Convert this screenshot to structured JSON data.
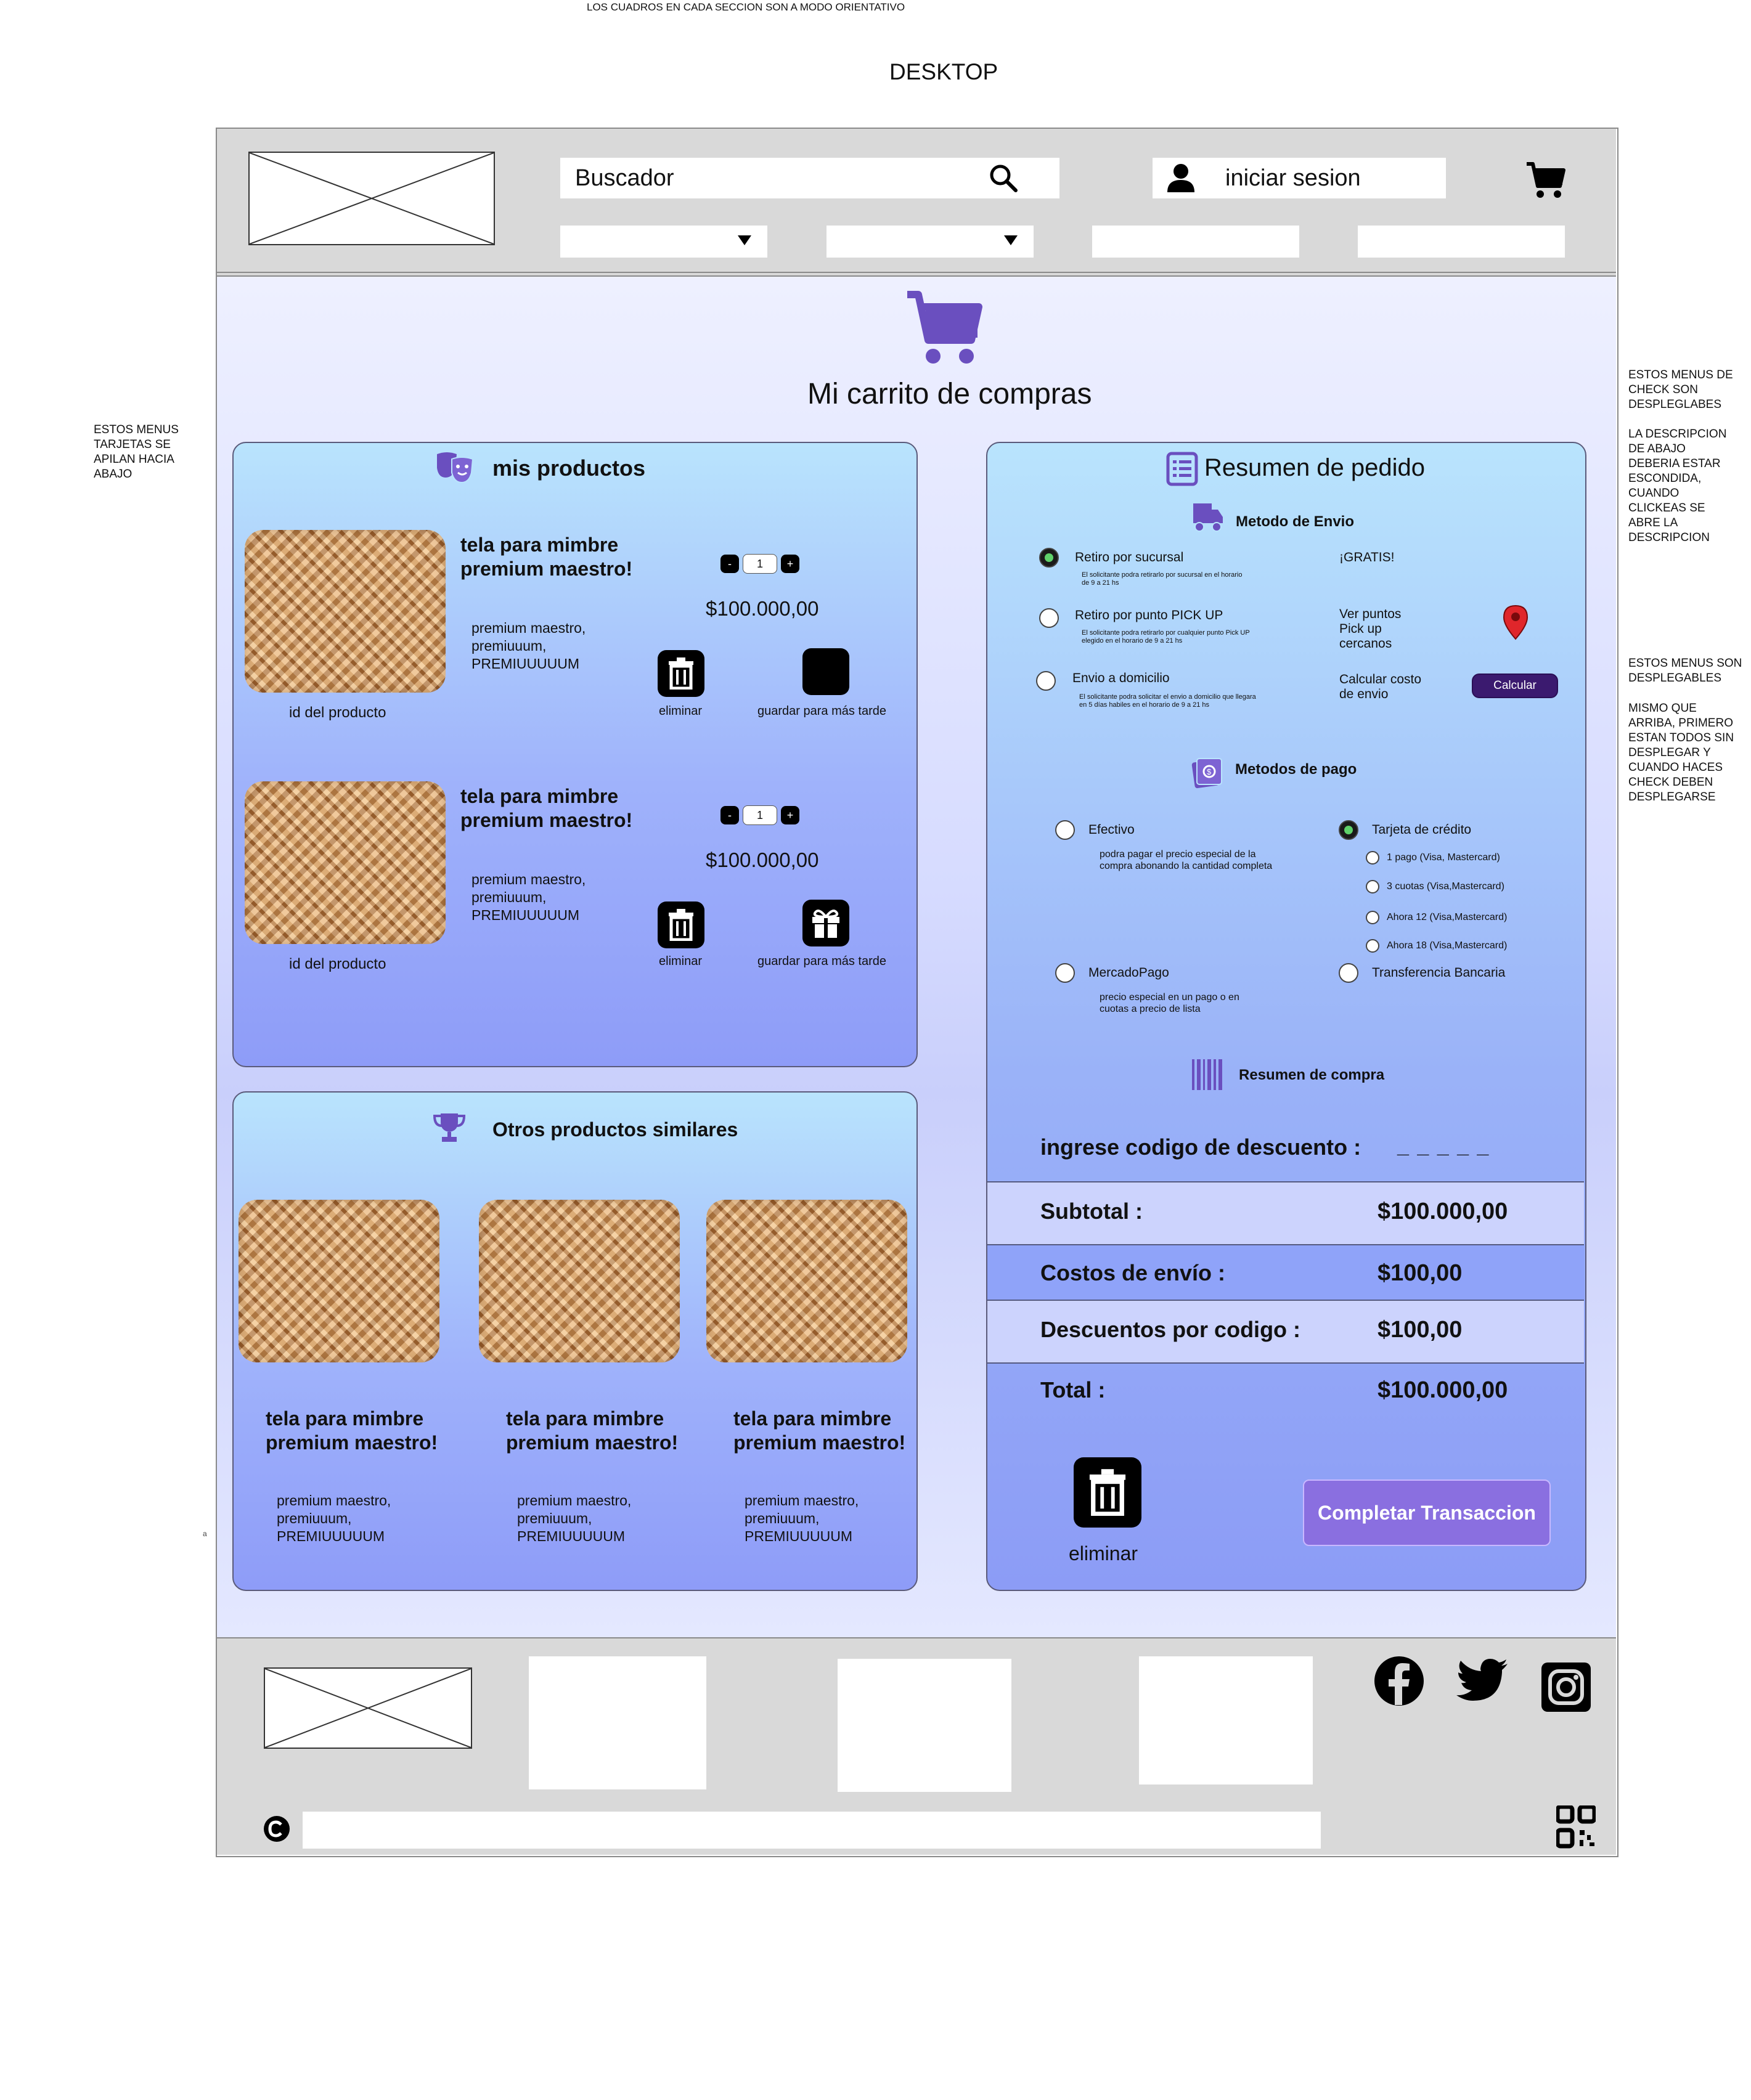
{
  "notes": {
    "top": "LOS CUADROS EN CADA SECCION SON A MODO ORIENTATIVO",
    "heading": "DESKTOP",
    "left": "ESTOS MENUS TARJETAS SE APILAN HACIA ABAJO",
    "right_1a": "ESTOS MENUS DE CHECK SON DESPLEGLABES",
    "right_1b": "LA DESCRIPCION DE ABAJO DEBERIA ESTAR ESCONDIDA, CUANDO CLICKEAS SE ABRE LA DESCRIPCION",
    "right_2a": "ESTOS MENUS SON DESPLEGABLES",
    "right_2b": "MISMO QUE ARRIBA, PRIMERO ESTAN TODOS SIN DESPLEGAR Y CUANDO HACES CHECK DEBEN DESPLEGARSE",
    "stray": "a"
  },
  "header": {
    "search_placeholder": "Buscador",
    "login_label": "iniciar sesion"
  },
  "page": {
    "title": "Mi carrito de compras"
  },
  "products_panel": {
    "title": "mis productos",
    "items": [
      {
        "name": "tela para mimbre premium maestro!",
        "description": "premium maestro, premiuuum, PREMIUUUUUM",
        "id_label": "id del producto",
        "qty_minus": "-",
        "qty": "1",
        "qty_plus": "+",
        "price": "$100.000,00",
        "delete_label": "eliminar",
        "save_label": "guardar para más tarde"
      },
      {
        "name": "tela para mimbre premium maestro!",
        "description": "premium maestro, premiuuum, PREMIUUUUUM",
        "id_label": "id del producto",
        "qty_minus": "-",
        "qty": "1",
        "qty_plus": "+",
        "price": "$100.000,00",
        "delete_label": "eliminar",
        "save_label": "guardar para más tarde"
      }
    ]
  },
  "similar_panel": {
    "title": "Otros productos similares",
    "items": [
      {
        "name": "tela para mimbre premium maestro!",
        "description": "premium maestro, premiuuum, PREMIUUUUUM"
      },
      {
        "name": "tela para mimbre premium maestro!",
        "description": "premium maestro, premiuuum, PREMIUUUUUM"
      },
      {
        "name": "tela para mimbre premium maestro!",
        "description": "premium maestro, premiuuum, PREMIUUUUUM"
      }
    ]
  },
  "summary": {
    "title": "Resumen de pedido",
    "shipping_title": "Metodo de Envio",
    "shipping": [
      {
        "label": "Retiro por sucursal",
        "desc": "El solicitante podra retirarlo por sucursal en el horario de 9 a 21 hs",
        "side": "¡GRATIS!",
        "selected": true
      },
      {
        "label": "Retiro por punto PICK UP",
        "desc": "El solicitante podra retirarlo por cualquier punto Pick UP elegido en el horario de 9 a 21 hs",
        "side": "Ver puntos Pick up cercanos",
        "selected": false
      },
      {
        "label": "Envio a domicilio",
        "desc": "El solicitante podra solicitar el envio a domicilio que llegara en 5 días habiles en el horario de 9 a 21 hs",
        "side": "Calcular costo de envio",
        "selected": false
      }
    ],
    "calc_button": "Calcular",
    "payment_title": "Metodos de pago",
    "payment": {
      "cash": {
        "label": "Efectivo",
        "desc": "podra pagar el precio especial de la compra abonando la cantidad completa"
      },
      "card": {
        "label": "Tarjeta de crédito",
        "selected": true,
        "options": [
          "1 pago (Visa, Mastercard)",
          "3 cuotas (Visa,Mastercard)",
          "Ahora 12 (Visa,Mastercard)",
          "Ahora 18 (Visa,Mastercard)"
        ]
      },
      "mp": {
        "label": "MercadoPago",
        "desc": "precio especial en un pago o en cuotas a precio de lista"
      },
      "transfer": {
        "label": "Transferencia Bancaria"
      }
    },
    "purchase_title": "Resumen de compra",
    "discount_label": "ingrese codigo de descuento :",
    "discount_value": "_ _ _ _ _",
    "rows": [
      {
        "label": "Subtotal :",
        "value": "$100.000,00"
      },
      {
        "label": "Costos de envío :",
        "value": "$100,00"
      },
      {
        "label": "Descuentos por codigo :",
        "value": "$100,00"
      },
      {
        "label": "Total :",
        "value": "$100.000,00"
      }
    ],
    "delete_label": "eliminar",
    "complete_button": "Completar Transaccion"
  },
  "colors": {
    "accent": "#6a4fbf",
    "button": "#8a6fe0",
    "header_bg": "#d9d9d9"
  }
}
